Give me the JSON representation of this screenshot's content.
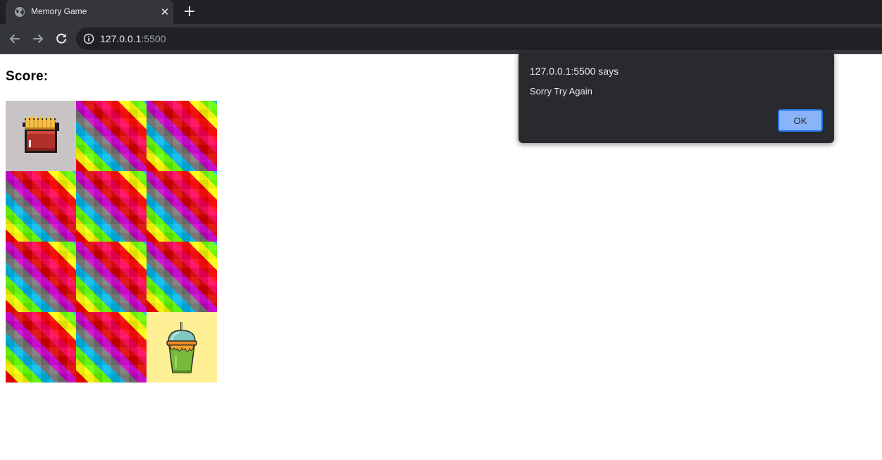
{
  "browser": {
    "tab_title": "Memory Game",
    "tab_close_label": "✕",
    "new_tab_label": "+",
    "url_host": "127.0.0.1",
    "url_port": ":5500"
  },
  "page": {
    "score_label": "Score:"
  },
  "board": {
    "columns": 3,
    "rows": 4,
    "cards": [
      {
        "state": "face-up",
        "icon": "fries-icon",
        "background": "#c8c4c6"
      },
      {
        "state": "face-down"
      },
      {
        "state": "face-down"
      },
      {
        "state": "face-down"
      },
      {
        "state": "face-down"
      },
      {
        "state": "face-down"
      },
      {
        "state": "face-down"
      },
      {
        "state": "face-down"
      },
      {
        "state": "face-down"
      },
      {
        "state": "face-down"
      },
      {
        "state": "face-down"
      },
      {
        "state": "face-up",
        "icon": "drink-cup-icon",
        "background": "#ffef94"
      }
    ]
  },
  "dialog": {
    "origin": "127.0.0.1:5500 says",
    "message": "Sorry Try Again",
    "ok_label": "OK"
  },
  "colors": {
    "chrome_dark": "#202124",
    "chrome_toolbar": "#35363a",
    "dialog_bg": "#292a2d",
    "ok_button": "#8ab4f8"
  }
}
